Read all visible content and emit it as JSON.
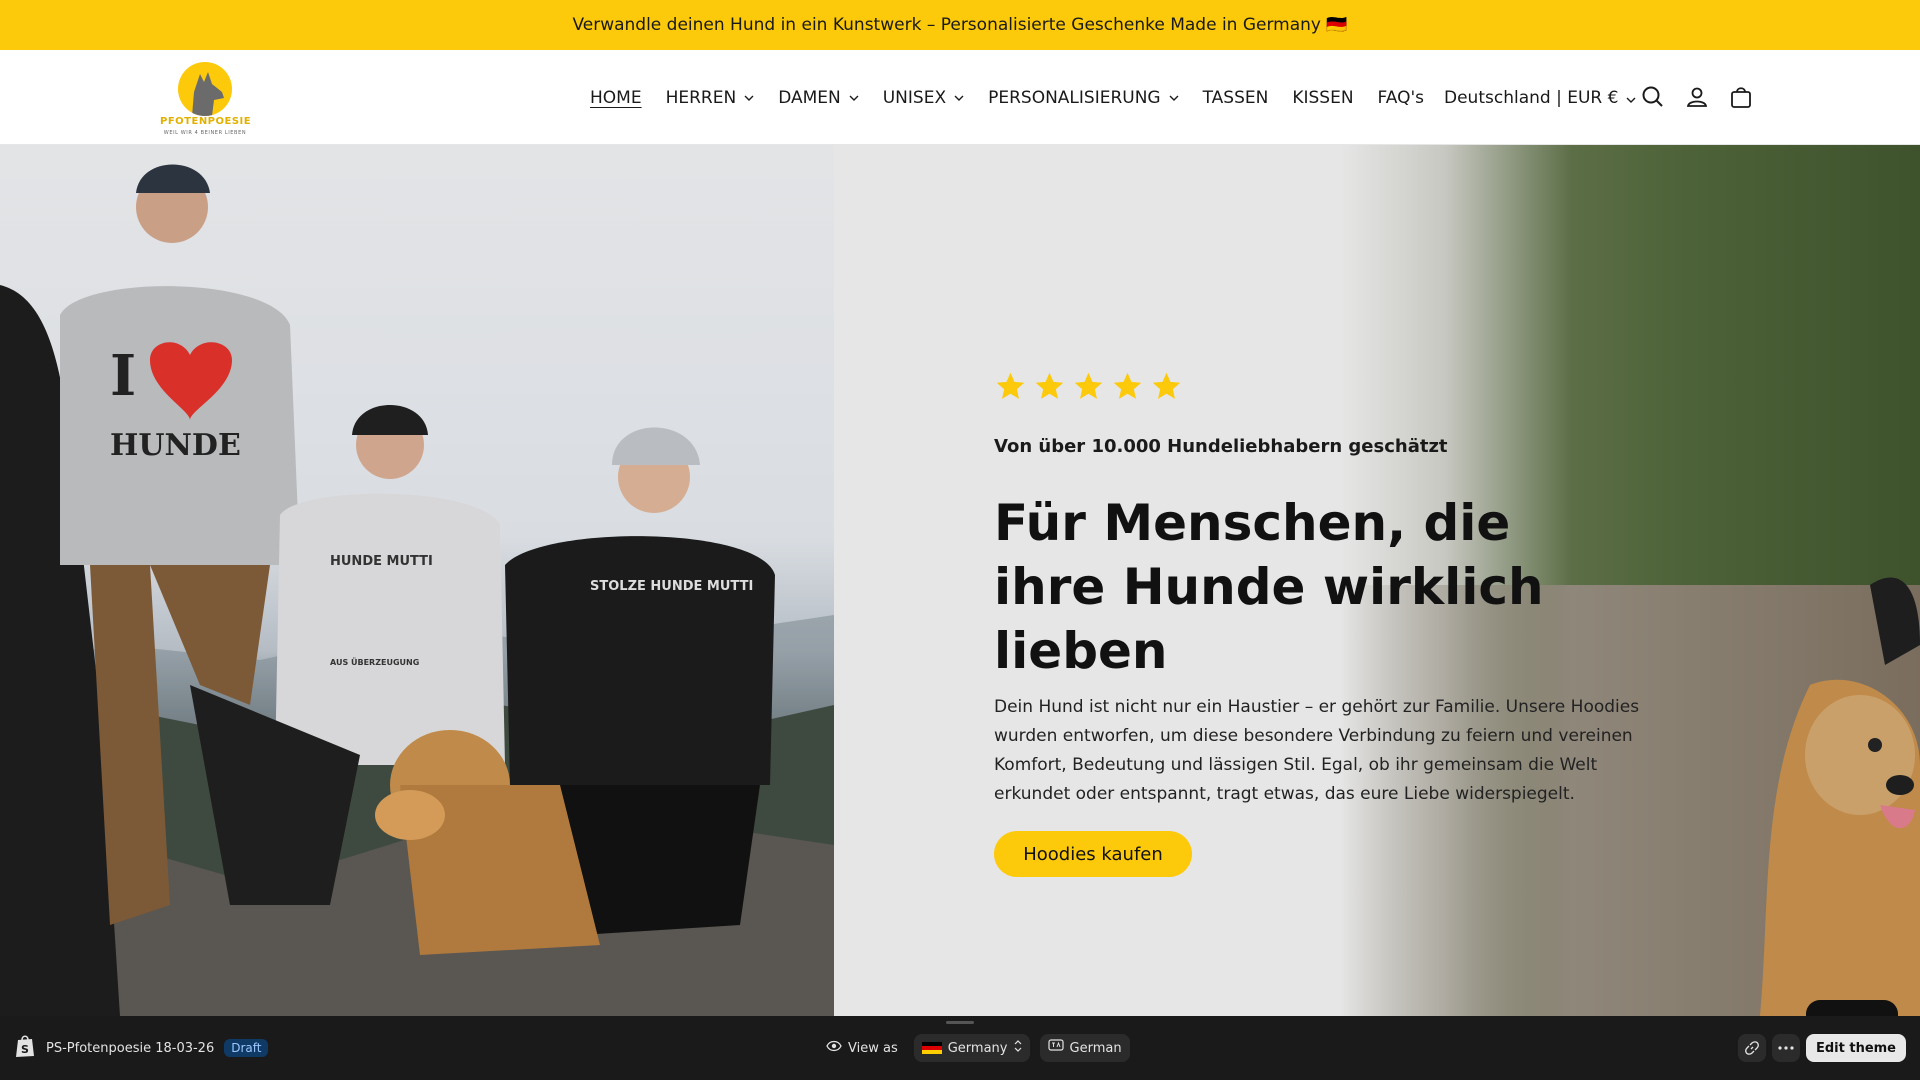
{
  "announcement": {
    "text": "Verwandle deinen Hund in ein Kunstwerk – Personalisierte Geschenke Made in Germany 🇩🇪"
  },
  "logo": {
    "name": "PFOTENPOESIE",
    "tagline": "WEIL WIR 4 BEINER LIEBEN"
  },
  "nav": {
    "items": [
      {
        "label": "HOME",
        "active": true,
        "dropdown": false
      },
      {
        "label": "HERREN",
        "active": false,
        "dropdown": true
      },
      {
        "label": "DAMEN",
        "active": false,
        "dropdown": true
      },
      {
        "label": "UNISEX",
        "active": false,
        "dropdown": true
      },
      {
        "label": "PERSONALISIERUNG",
        "active": false,
        "dropdown": true
      },
      {
        "label": "TASSEN",
        "active": false,
        "dropdown": false
      },
      {
        "label": "KISSEN",
        "active": false,
        "dropdown": false
      },
      {
        "label": "FAQ's",
        "active": false,
        "dropdown": false
      }
    ],
    "locale": "Deutschland | EUR €",
    "icons": [
      "search-icon",
      "account-icon",
      "cart-icon"
    ]
  },
  "hero": {
    "rating_stars": 5,
    "trust_line": "Von über 10.000 Hundeliebhabern geschätzt",
    "headline": "Für Menschen, die ihre Hunde wirklich lieben",
    "body": "Dein Hund ist nicht nur ein Haustier – er gehört zur Familie. Unsere Hoodies wurden entworfen, um diese besondere Verbindung zu feiern und vereinen Komfort, Bedeutung und lässigen Stil. Egal, ob ihr gemeinsam die Welt erkundet oder entspannt, tragt etwas, das eure Liebe widerspiegelt.",
    "cta_label": "Hoodies kaufen",
    "image_texts": {
      "hoodie_1": "I ♥ HUNDE",
      "hoodie_2": "HUNDE MUTTI AUS ÜBERZEUGUNG",
      "hoodie_3": "STOLZE HUNDE MUTTI"
    }
  },
  "colors": {
    "accent": "#fcc90b",
    "bar_bg": "#1a1a1a"
  },
  "preview_bar": {
    "store_name": "PS-Pfotenpoesie 18-03-26",
    "status_badge": "Draft",
    "view_as_label": "View as",
    "country": "Germany",
    "language": "German",
    "edit_label": "Edit theme"
  }
}
